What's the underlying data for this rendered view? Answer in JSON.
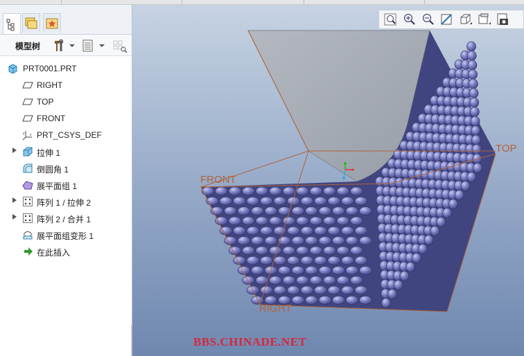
{
  "tree_panel": {
    "title": "模型树",
    "items": [
      {
        "label": "PRT0001.PRT",
        "icon": "part-icon",
        "expandable": false
      },
      {
        "label": "RIGHT",
        "icon": "datum-plane-icon",
        "expandable": false
      },
      {
        "label": "TOP",
        "icon": "datum-plane-icon",
        "expandable": false
      },
      {
        "label": "FRONT",
        "icon": "datum-plane-icon",
        "expandable": false
      },
      {
        "label": "PRT_CSYS_DEF",
        "icon": "coordinate-system-icon",
        "expandable": false
      },
      {
        "label": "拉伸 1",
        "icon": "extrude-icon",
        "expandable": true
      },
      {
        "label": "倒圆角 1",
        "icon": "round-icon",
        "expandable": false
      },
      {
        "label": "展平面组 1",
        "icon": "flatten-quilt-icon",
        "expandable": false
      },
      {
        "label": "阵列 1 / 拉伸 2",
        "icon": "pattern-icon",
        "expandable": true
      },
      {
        "label": "阵列 2 / 合并 1",
        "icon": "pattern-icon",
        "expandable": true
      },
      {
        "label": "展平面组变形 1",
        "icon": "flatten-deform-icon",
        "expandable": false
      },
      {
        "label": "在此插入",
        "icon": "insert-here-arrow-icon",
        "expandable": false
      }
    ]
  },
  "viewport": {
    "datum_labels": {
      "front": "FRONT",
      "top": "TOP",
      "right": "RIGHT"
    },
    "toolbar_icons": [
      "refit-zoom-icon",
      "zoom-in-icon",
      "zoom-out-icon",
      "repaint-icon",
      "display-style-icon",
      "view-manager-icon",
      "saved-views-icon"
    ],
    "background_color": "#7d95b8",
    "model_color": "#6b6fb5",
    "surface_color": "#a6acb5",
    "datum_color": "#b0643a"
  },
  "watermark": "BBS.CHINADE.NET"
}
